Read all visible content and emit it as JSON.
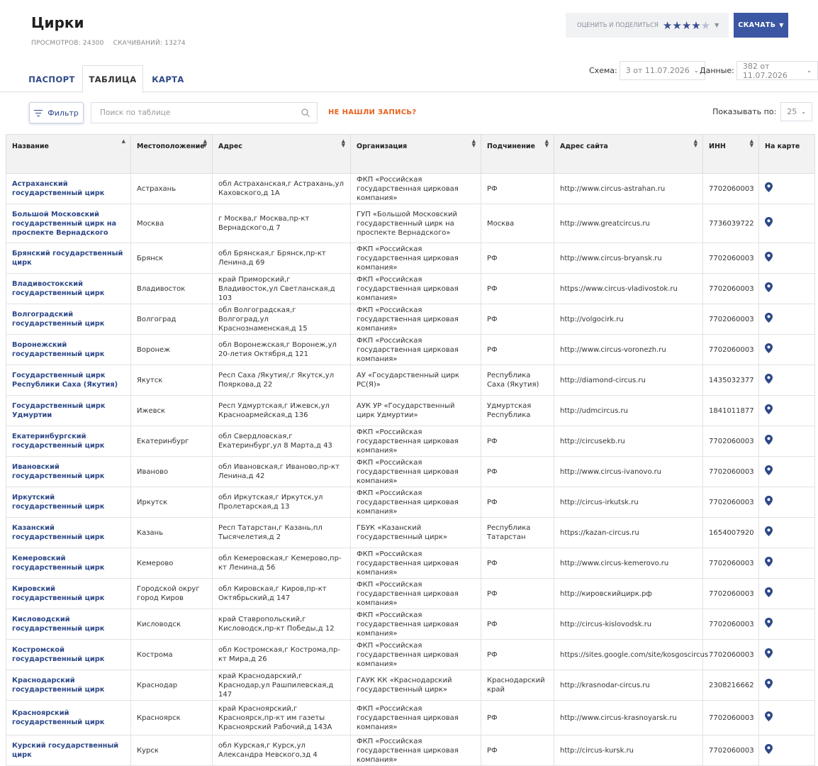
{
  "page": {
    "title": "Цирки",
    "views": "ПРОСМОТРОВ: 24300",
    "downloads": "СКАЧИВАНИЙ: 13274"
  },
  "rating": {
    "label": "ОЦЕНИТЬ И ПОДЕЛИТЬСЯ",
    "stars": 4,
    "max": 5
  },
  "download_button": "СКАЧАТЬ",
  "tabs": [
    {
      "label": "ПАСПОРТ"
    },
    {
      "label": "ТАБЛИЦА"
    },
    {
      "label": "КАРТА"
    }
  ],
  "schema": {
    "label": "Схема:",
    "value": "3 от 11.07.2026"
  },
  "data_version": {
    "label": "Данные:",
    "value": "382 от 11.07.2026"
  },
  "toolbar": {
    "filter_label": "Фильтр",
    "search_placeholder": "Поиск по таблице",
    "not_found": "НЕ НАШЛИ ЗАПИСЬ?",
    "per_page_label": "Показывать по:",
    "per_page_value": "25"
  },
  "columns": [
    "Название",
    "Местоположение",
    "Адрес",
    "Организация",
    "Подчинение",
    "Адрес сайта",
    "ИНН",
    "На карте"
  ],
  "rows": [
    {
      "name": "Астраханский государственный цирк",
      "location": "Астрахань",
      "address": "обл Астраханская,г Астрахань,ул Каховского,д 1А",
      "org": "ФКП «Российская государственная цирковая компания»",
      "sub": "РФ",
      "site": "http://www.circus-astrahan.ru",
      "inn": "7702060003"
    },
    {
      "name": "Большой Московский государственный цирк на проспекте Вернадского",
      "location": "Москва",
      "address": "г Москва,г Москва,пр-кт Вернадского,д 7",
      "org": "ГУП «Большой Московский государственный цирк на проспекте Вернадского»",
      "sub": "Москва",
      "site": "http://www.greatcircus.ru",
      "inn": "7736039722"
    },
    {
      "name": "Брянский государственный цирк",
      "location": "Брянск",
      "address": "обл Брянская,г Брянск,пр-кт Ленина,д 69",
      "org": "ФКП «Российская государственная цирковая компания»",
      "sub": "РФ",
      "site": "http://www.circus-bryansk.ru",
      "inn": "7702060003"
    },
    {
      "name": "Владивостокский государственный цирк",
      "location": "Владивосток",
      "address": "край Приморский,г Владивосток,ул Светланская,д 103",
      "org": "ФКП «Российская государственная цирковая компания»",
      "sub": "РФ",
      "site": "https://www.circus-vladivostok.ru",
      "inn": "7702060003"
    },
    {
      "name": "Волгоградский государственный цирк",
      "location": "Волгоград",
      "address": "обл Волгоградская,г Волгоград,ул Краснознаменская,д 15",
      "org": "ФКП «Российская государственная цирковая компания»",
      "sub": "РФ",
      "site": "http://volgocirk.ru",
      "inn": "7702060003"
    },
    {
      "name": "Воронежский государственный цирк",
      "location": "Воронеж",
      "address": "обл Воронежская,г Воронеж,ул 20-летия Октября,д 121",
      "org": "ФКП «Российская государственная цирковая компания»",
      "sub": "РФ",
      "site": "http://www.circus-voronezh.ru",
      "inn": "7702060003"
    },
    {
      "name": "Государственный цирк Республики Саха (Якутия)",
      "location": "Якутск",
      "address": "Респ Саха /Якутия/,г Якутск,ул Пояркова,д 22",
      "org": "АУ «Государственный цирк РС(Я)»",
      "sub": "Республика Саха (Якутия)",
      "site": "http://diamond-circus.ru",
      "inn": "1435032377"
    },
    {
      "name": "Государственный цирк Удмуртии",
      "location": "Ижевск",
      "address": "Респ Удмуртская,г Ижевск,ул Красноармейская,д 136",
      "org": "АУК УР «Государственный цирк Удмуртии»",
      "sub": "Удмуртская Республика",
      "site": "http://udmcircus.ru",
      "inn": "1841011877"
    },
    {
      "name": "Екатеринбургский государственный цирк",
      "location": "Екатеринбург",
      "address": "обл Свердловская,г Екатеринбург,ул 8 Марта,д 43",
      "org": "ФКП «Российская государственная цирковая компания»",
      "sub": "РФ",
      "site": "http://circusekb.ru",
      "inn": "7702060003"
    },
    {
      "name": "Ивановский государственный цирк",
      "location": "Иваново",
      "address": "обл Ивановская,г Иваново,пр-кт Ленина,д 42",
      "org": "ФКП «Российская государственная цирковая компания»",
      "sub": "РФ",
      "site": "http://www.circus-ivanovo.ru",
      "inn": "7702060003"
    },
    {
      "name": "Иркутский государственный цирк",
      "location": "Иркутск",
      "address": "обл Иркутская,г Иркутск,ул Пролетарская,д 13",
      "org": "ФКП «Российская государственная цирковая компания»",
      "sub": "РФ",
      "site": "http://circus-irkutsk.ru",
      "inn": "7702060003"
    },
    {
      "name": "Казанский государственный цирк",
      "location": "Казань",
      "address": "Респ Татарстан,г Казань,пл Тысячелетия,д 2",
      "org": "ГБУК «Казанский государственный цирк»",
      "sub": "Республика Татарстан",
      "site": "https://kazan-circus.ru",
      "inn": "1654007920"
    },
    {
      "name": "Кемеровский государственный цирк",
      "location": "Кемерово",
      "address": "обл Кемеровская,г Кемерово,пр-кт Ленина,д 56",
      "org": "ФКП «Российская государственная цирковая компания»",
      "sub": "РФ",
      "site": "http://www.circus-kemerovo.ru",
      "inn": "7702060003"
    },
    {
      "name": "Кировский государственный цирк",
      "location": "Городской округ город Киров",
      "address": "обл Кировская,г Киров,пр-кт Октябрьский,д 147",
      "org": "ФКП «Российская государственная цирковая компания»",
      "sub": "РФ",
      "site": "http://кировскийцирк.рф",
      "inn": "7702060003"
    },
    {
      "name": "Кисловодский государственный цирк",
      "location": "Кисловодск",
      "address": "край Ставропольский,г Кисловодск,пр-кт Победы,д 12",
      "org": "ФКП «Российская государственная цирковая компания»",
      "sub": "РФ",
      "site": "http://circus-kislovodsk.ru",
      "inn": "7702060003"
    },
    {
      "name": "Костромской государственный цирк",
      "location": "Кострома",
      "address": "обл Костромская,г Кострома,пр-кт Мира,д 26",
      "org": "ФКП «Российская государственная цирковая компания»",
      "sub": "РФ",
      "site": "https://sites.google.com/site/kosgoscircus",
      "inn": "7702060003"
    },
    {
      "name": "Краснодарский государственный цирк",
      "location": "Краснодар",
      "address": "край Краснодарский,г Краснодар,ул Рашпилевская,д 147",
      "org": "ГАУК КК «Краснодарский государственный цирк»",
      "sub": "Краснодарский край",
      "site": "http://krasnodar-circus.ru",
      "inn": "2308216662"
    },
    {
      "name": "Красноярский государственный цирк",
      "location": "Красноярск",
      "address": "край Красноярский,г Красноярск,пр-кт им газеты Красноярский Рабочий,д 143А",
      "org": "ФКП «Российская государственная цирковая компания»",
      "sub": "РФ",
      "site": "http://www.circus-krasnoyarsk.ru",
      "inn": "7702060003"
    },
    {
      "name": "Курский государственный цирк",
      "location": "Курск",
      "address": "обл Курская,г Курск,ул Александра Невского,зд 4",
      "org": "ФКП «Российская государственная цирковая компания»",
      "sub": "РФ",
      "site": "http://circus-kursk.ru",
      "inn": "7702060003"
    }
  ],
  "colors": {
    "accent": "#2d4889",
    "button": "#3b56a2",
    "warning": "#e8621f"
  }
}
